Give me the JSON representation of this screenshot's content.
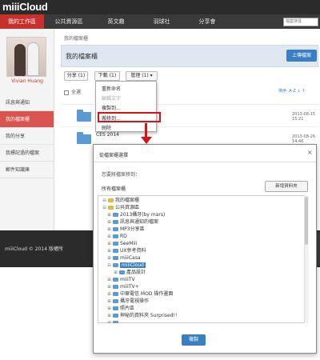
{
  "app": {
    "logo": "miiiCloud"
  },
  "header": {
    "search_placeholder": "檔案搜尋",
    "nav": [
      "我的工作區",
      "公共資源區",
      "英文趣",
      "羽球社",
      "分享會"
    ]
  },
  "sidebar": {
    "username": "Vivian Huang",
    "items": [
      "訊息與通知",
      "我的檔案櫃",
      "我的分享",
      "我標記過的檔案",
      "郵件知識庫"
    ]
  },
  "main": {
    "breadcrumb": "我的檔案櫃",
    "title": "我的檔案櫃",
    "upload_label": "上傳檔案",
    "toolbar": {
      "share": "分享 (1)",
      "download": "下載 (1)",
      "manage": "管理 (1) ▾"
    },
    "select_all": "全選",
    "sort_label": "排序: A-Z ↓ ↑",
    "rows": [
      {
        "name": "",
        "date": "2013-08-15 15:21"
      },
      {
        "name": "CES 2014",
        "date": "2013-08-26 14:46"
      }
    ],
    "context_menu": [
      "重新命名",
      "編輯文字",
      "複製到...",
      "搬移到...",
      "刪除"
    ]
  },
  "footer": {
    "copyright": "miiiCloud © 2014 版權所"
  },
  "dialog": {
    "title": "從檔案櫃選擇",
    "close": "×",
    "label": "您要將檔案移到：",
    "section": "所有檔案櫃",
    "new_folder": "新增資料夾",
    "tree": [
      {
        "label": "我的檔案櫃",
        "toggle": "⊟"
      },
      {
        "label": "公共資源區",
        "toggle": "⊟"
      },
      {
        "label": "2013攝牙(by mars)",
        "toggle": "⊞"
      },
      {
        "label": "訊息與通知的檔案",
        "toggle": "⊞"
      },
      {
        "label": "MP3分享區",
        "toggle": "⊞"
      },
      {
        "label": "RD",
        "toggle": "⊞"
      },
      {
        "label": "SeeMiii",
        "toggle": "⊞"
      },
      {
        "label": "UX參考資料",
        "toggle": "⊞"
      },
      {
        "label": "miiiCasa",
        "toggle": "⊞"
      },
      {
        "label": "miiiCloud",
        "toggle": "⊟"
      },
      {
        "label": "產品設計",
        "toggle": "⊞"
      },
      {
        "label": "miiiTV",
        "toggle": "⊞"
      },
      {
        "label": "miiiTV+",
        "toggle": "⊞"
      },
      {
        "label": "中華電信 MOD 操作畫面",
        "toggle": "⊞"
      },
      {
        "label": "攝牙電視操作",
        "toggle": "⊞"
      },
      {
        "label": "照片區",
        "toggle": "⊞"
      },
      {
        "label": "神秘的資料夾 Surprised!!",
        "toggle": "⊞"
      },
      {
        "label": "",
        "toggle": "⊞"
      }
    ],
    "copy_label": "複製"
  },
  "colors": {
    "accent": "#c9302c",
    "primary": "#3a7fc1",
    "highlight": "#dd1111"
  }
}
